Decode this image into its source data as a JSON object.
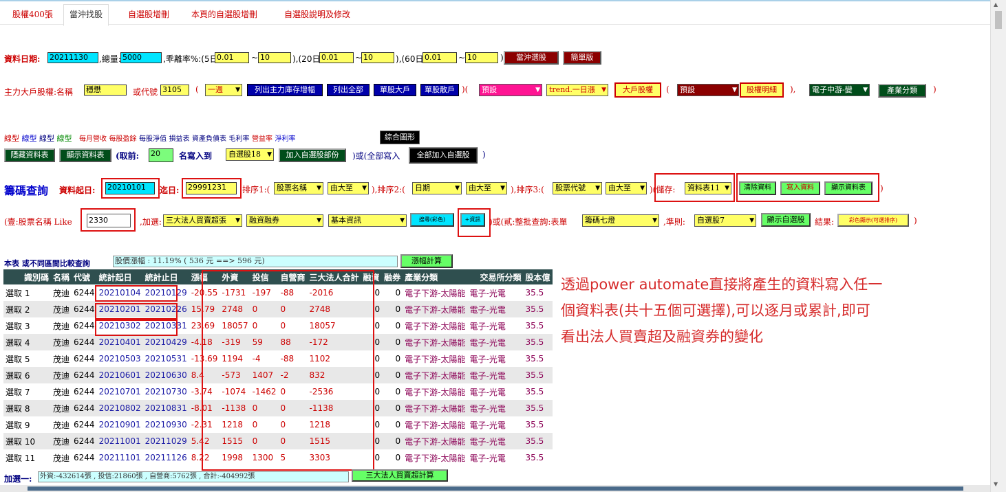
{
  "tabs": [
    "股權400張",
    "當沖找股",
    "自選股增刪",
    "本頁的自選股增刪",
    "自選股說明及修改"
  ],
  "row1": {
    "date_label": "資料日期:",
    "date_value": "20211130",
    "vol_label": ",總量:",
    "vol_value": "5000",
    "dev_label": ",乖離率%:(5日:",
    "d5a": "0.01",
    "sep": "~",
    "d5b": "10",
    "p20": "),(20日:",
    "d20a": "0.01",
    "d20b": "10",
    "p60": "),(60日:",
    "d60a": "0.01",
    "d60b": "10",
    "close": ")",
    "btn1": "當沖選股",
    "btn2": "簡單版"
  },
  "row2": {
    "label": "主力大戶股權:名稱",
    "name": "穩懋",
    "or_code": "或代號",
    "code": "3105",
    "paren": "(",
    "period": "一週",
    "b1": "列出主力庫存增幅",
    "b2": "列出全部",
    "b3": "單股大戶",
    "b4": "單股散戶",
    "mid": ")(",
    "s1": "預設",
    "s2": "trend.一日漲",
    "b5": "大戶股權",
    "paren2": "(",
    "s3": "預設",
    "b6": "股權明細",
    "close2": "),",
    "s4": "電子中游-變",
    "b7": "產業分類",
    "close3": ")"
  },
  "row3": {
    "links": [
      "線型",
      "線型",
      "線型",
      "線型"
    ],
    "items": [
      "每月營收",
      "每股盈餘",
      "每股淨值",
      "損益表",
      "資產負債表",
      "毛利率",
      "營益率",
      "淨利率"
    ],
    "btn": "綜合圖形"
  },
  "row4": {
    "b1": "隱藏資料表",
    "b2": "顯示資料表",
    "take": "(取前:",
    "take_val": "20",
    "write": "名寫入到",
    "sel": "自選股18",
    "b3": "加入自選股部份",
    "or": ")或(全部寫入",
    "b4": "全部加入自選股",
    "close": ")"
  },
  "row5": {
    "title": "籌碼查詢",
    "from_label": "資料起日:",
    "from": "20210101",
    "to_label": "迄日:",
    "to": "29991231",
    "sort1": "排序1:(",
    "s1a": "股票名稱",
    "s1b": "由大至",
    "sort2": "),排序2:(",
    "s2a": "日期",
    "s2b": "由大至",
    "sort3": "),排序3:(",
    "s3a": "股票代號",
    "s3b": "由大至",
    "save": ")(儲存:",
    "save_sel": "資料表11",
    "b1": "清除資料",
    "b2": "寫入資料",
    "b3": "顯示資料表",
    "close": ")"
  },
  "row6": {
    "label": "(壹:股票名稱 Like",
    "like": "2330",
    "add": ",加選:",
    "s1": "三大法人買賣超張",
    "s2": "融資融券",
    "s3": "基本資訊",
    "b1": "搜尋(彩色)",
    "b2": "+資訊",
    "or": ")或(貳:整批查詢:表單",
    "s4": "籌碼七燈",
    "rule": ",準則:",
    "s5": "自選股7",
    "b3": "顯示自選股",
    "result": "結果:",
    "b4": "彩色顯示(可選排序)",
    "close": ")"
  },
  "row7": {
    "title": "本表 或不同區間比較查詢",
    "info": "股價漲幅 : 11.19% ( 536 元 ==> 596 元)",
    "btn": "漲幅計算"
  },
  "table": {
    "headers": [
      "識別碼",
      "名稱",
      "代號",
      "統計起日",
      "統計止日",
      "漲幅",
      "外資",
      "投信",
      "自營商",
      "三大法人合計",
      "融資",
      "融券",
      "產業分類",
      "交易所分類",
      "股本億"
    ],
    "rows": [
      [
        "選取 1",
        "茂迪",
        "6244",
        "20210104",
        "20210129",
        "-20.55",
        "-1731",
        "-197",
        "-88",
        "-2016",
        "0",
        "0",
        "電子下游-太陽能",
        "電子-光電",
        "35.5"
      ],
      [
        "選取 2",
        "茂迪",
        "6244",
        "20210201",
        "20210226",
        "15.79",
        "2748",
        "0",
        "0",
        "2748",
        "0",
        "0",
        "電子下游-太陽能",
        "電子-光電",
        "35.5"
      ],
      [
        "選取 3",
        "茂迪",
        "6244",
        "20210302",
        "20210331",
        "23.69",
        "18057",
        "0",
        "0",
        "18057",
        "0",
        "0",
        "電子下游-太陽能",
        "電子-光電",
        "35.5"
      ],
      [
        "選取 4",
        "茂迪",
        "6244",
        "20210401",
        "20210429",
        "-4.18",
        "-319",
        "59",
        "88",
        "-172",
        "0",
        "0",
        "電子下游-太陽能",
        "電子-光電",
        "35.5"
      ],
      [
        "選取 5",
        "茂迪",
        "6244",
        "20210503",
        "20210531",
        "-13.69",
        "1194",
        "-4",
        "-88",
        "1102",
        "0",
        "0",
        "電子下游-太陽能",
        "電子-光電",
        "35.5"
      ],
      [
        "選取 6",
        "茂迪",
        "6244",
        "20210601",
        "20210630",
        "8.4",
        "-573",
        "1407",
        "-2",
        "832",
        "0",
        "0",
        "電子下游-太陽能",
        "電子-光電",
        "35.5"
      ],
      [
        "選取 7",
        "茂迪",
        "6244",
        "20210701",
        "20210730",
        "-3.74",
        "-1074",
        "-1462",
        "0",
        "-2536",
        "0",
        "0",
        "電子下游-太陽能",
        "電子-光電",
        "35.5"
      ],
      [
        "選取 8",
        "茂迪",
        "6244",
        "20210802",
        "20210831",
        "-8.01",
        "-1138",
        "0",
        "0",
        "-1138",
        "0",
        "0",
        "電子下游-太陽能",
        "電子-光電",
        "35.5"
      ],
      [
        "選取 9",
        "茂迪",
        "6244",
        "20210901",
        "20210930",
        "-2.31",
        "1218",
        "0",
        "0",
        "1218",
        "0",
        "0",
        "電子下游-太陽能",
        "電子-光電",
        "35.5"
      ],
      [
        "選取 10",
        "茂迪",
        "6244",
        "20211001",
        "20211029",
        "5.42",
        "1515",
        "0",
        "0",
        "1515",
        "0",
        "0",
        "電子下游-太陽能",
        "電子-光電",
        "35.5"
      ],
      [
        "選取 11",
        "茂迪",
        "6244",
        "20211101",
        "20211126",
        "8.22",
        "1998",
        "1300",
        "5",
        "3303",
        "0",
        "0",
        "電子下游-太陽能",
        "電子-光電",
        "35.5"
      ]
    ]
  },
  "footer": {
    "label": "加選一:",
    "info": "外資:-432614張 , 投信:21860張 , 自營商:5762張 , 合計:-404992張",
    "btn": "三大法人買賣超計算"
  },
  "annotation": "透過power automate直接將產生的資料寫入任一個資料表(共十五個可選擇),可以逐月或累計,即可看出法人買賣超及融資券的變化"
}
